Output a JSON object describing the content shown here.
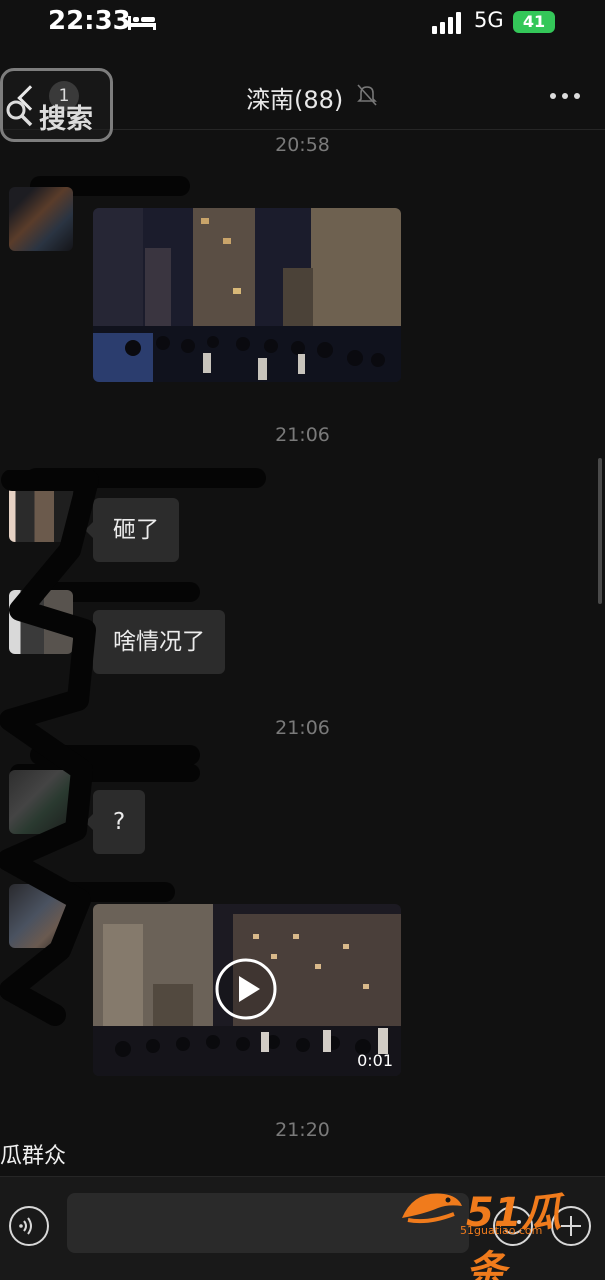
{
  "status_bar": {
    "time": "22:33",
    "network": "5G",
    "battery": "41"
  },
  "header": {
    "back_count": "1",
    "search_label": "搜索",
    "title": "滦南(88)"
  },
  "messages": {
    "ts1": "20:58",
    "ts2": "21:06",
    "msg1": "砸了",
    "msg2": "啥情况了",
    "ts3": "21:06",
    "msg3": "?",
    "video_duration": "0:01",
    "ts4": "21:20",
    "partial_sender": "瓜群众"
  },
  "watermark": {
    "brand": "51瓜条",
    "url": "51guatiao.com"
  },
  "colors": {
    "background": "#111111",
    "bubble": "#2c2c2c",
    "battery": "#34c759",
    "watermark": "#f07b1c"
  }
}
